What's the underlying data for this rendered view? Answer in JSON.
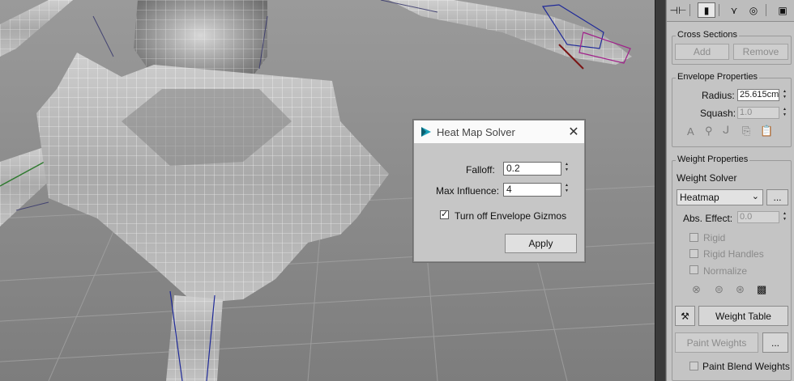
{
  "toolbar": {
    "icons": [
      "pin-icon",
      "modify-icon",
      "hierarchy-icon",
      "motion-icon",
      "display-icon"
    ]
  },
  "cross_sections": {
    "title": "Cross Sections",
    "add_label": "Add",
    "remove_label": "Remove"
  },
  "envelope_properties": {
    "title": "Envelope Properties",
    "radius_label": "Radius:",
    "radius_value": "25.615cm",
    "squash_label": "Squash:",
    "squash_value": "1.0",
    "icon_a": "A"
  },
  "weight_properties": {
    "title": "Weight Properties",
    "solver_label": "Weight Solver",
    "solver_value": "Heatmap",
    "more_label": "...",
    "abs_effect_label": "Abs. Effect:",
    "abs_effect_value": "0.0",
    "rigid_label": "Rigid",
    "rigid_handles_label": "Rigid Handles",
    "normalize_label": "Normalize",
    "weight_table_label": "Weight Table",
    "paint_weights_label": "Paint Weights",
    "paint_more_label": "...",
    "paint_blend_label": "Paint Blend Weights"
  },
  "dialog": {
    "title": "Heat Map Solver",
    "falloff_label": "Falloff:",
    "falloff_value": "0.2",
    "max_influence_label": "Max Influence:",
    "max_influence_value": "4",
    "gizmo_label": "Turn off Envelope Gizmos",
    "gizmo_checked": true,
    "apply_label": "Apply"
  },
  "colors": {
    "panel_bg": "#c4c4c4",
    "viewport_bg": "#8e8e8e",
    "mesh_wire": "#ffffff",
    "bone_wire": "#1f2a99",
    "envelope_wire": "#a0208a"
  }
}
